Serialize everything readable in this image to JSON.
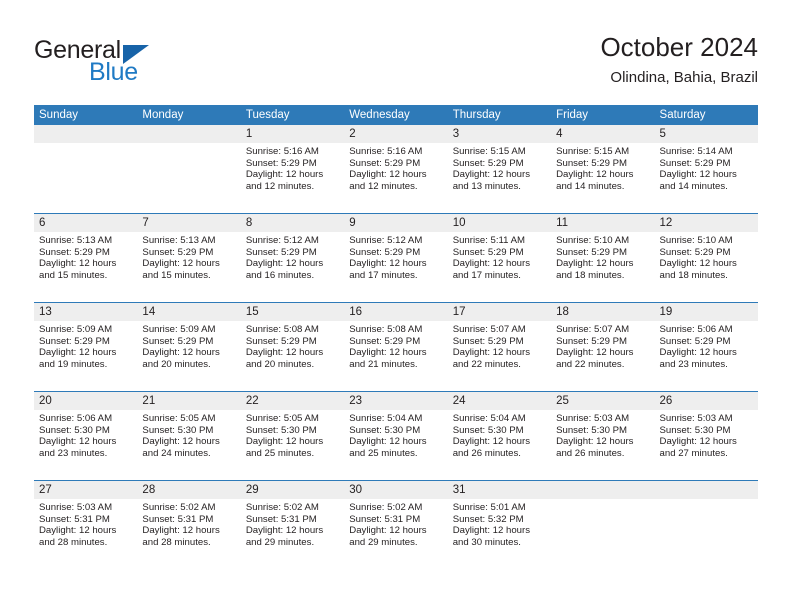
{
  "brand": {
    "word1": "General",
    "word2": "Blue",
    "triangle_color": "#1763a8",
    "blue_text_color": "#1f7ac4"
  },
  "header": {
    "title": "October 2024",
    "subtitle": "Olindina, Bahia, Brazil"
  },
  "theme": {
    "header_blue": "#2e7ab8",
    "number_band_gray": "#eeeeee",
    "text_color": "#231f20"
  },
  "weekday_headers": [
    "Sunday",
    "Monday",
    "Tuesday",
    "Wednesday",
    "Thursday",
    "Friday",
    "Saturday"
  ],
  "labels": {
    "sunrise_prefix": "Sunrise:",
    "sunset_prefix": "Sunset:",
    "daylight_prefix": "Daylight:"
  },
  "weeks": [
    [
      {
        "day": "",
        "line1": "",
        "line2": "",
        "line3": "",
        "line4": ""
      },
      {
        "day": "",
        "line1": "",
        "line2": "",
        "line3": "",
        "line4": ""
      },
      {
        "day": "1",
        "line1": "Sunrise: 5:16 AM",
        "line2": "Sunset: 5:29 PM",
        "line3": "Daylight: 12 hours",
        "line4": "and 12 minutes."
      },
      {
        "day": "2",
        "line1": "Sunrise: 5:16 AM",
        "line2": "Sunset: 5:29 PM",
        "line3": "Daylight: 12 hours",
        "line4": "and 12 minutes."
      },
      {
        "day": "3",
        "line1": "Sunrise: 5:15 AM",
        "line2": "Sunset: 5:29 PM",
        "line3": "Daylight: 12 hours",
        "line4": "and 13 minutes."
      },
      {
        "day": "4",
        "line1": "Sunrise: 5:15 AM",
        "line2": "Sunset: 5:29 PM",
        "line3": "Daylight: 12 hours",
        "line4": "and 14 minutes."
      },
      {
        "day": "5",
        "line1": "Sunrise: 5:14 AM",
        "line2": "Sunset: 5:29 PM",
        "line3": "Daylight: 12 hours",
        "line4": "and 14 minutes."
      }
    ],
    [
      {
        "day": "6",
        "line1": "Sunrise: 5:13 AM",
        "line2": "Sunset: 5:29 PM",
        "line3": "Daylight: 12 hours",
        "line4": "and 15 minutes."
      },
      {
        "day": "7",
        "line1": "Sunrise: 5:13 AM",
        "line2": "Sunset: 5:29 PM",
        "line3": "Daylight: 12 hours",
        "line4": "and 15 minutes."
      },
      {
        "day": "8",
        "line1": "Sunrise: 5:12 AM",
        "line2": "Sunset: 5:29 PM",
        "line3": "Daylight: 12 hours",
        "line4": "and 16 minutes."
      },
      {
        "day": "9",
        "line1": "Sunrise: 5:12 AM",
        "line2": "Sunset: 5:29 PM",
        "line3": "Daylight: 12 hours",
        "line4": "and 17 minutes."
      },
      {
        "day": "10",
        "line1": "Sunrise: 5:11 AM",
        "line2": "Sunset: 5:29 PM",
        "line3": "Daylight: 12 hours",
        "line4": "and 17 minutes."
      },
      {
        "day": "11",
        "line1": "Sunrise: 5:10 AM",
        "line2": "Sunset: 5:29 PM",
        "line3": "Daylight: 12 hours",
        "line4": "and 18 minutes."
      },
      {
        "day": "12",
        "line1": "Sunrise: 5:10 AM",
        "line2": "Sunset: 5:29 PM",
        "line3": "Daylight: 12 hours",
        "line4": "and 18 minutes."
      }
    ],
    [
      {
        "day": "13",
        "line1": "Sunrise: 5:09 AM",
        "line2": "Sunset: 5:29 PM",
        "line3": "Daylight: 12 hours",
        "line4": "and 19 minutes."
      },
      {
        "day": "14",
        "line1": "Sunrise: 5:09 AM",
        "line2": "Sunset: 5:29 PM",
        "line3": "Daylight: 12 hours",
        "line4": "and 20 minutes."
      },
      {
        "day": "15",
        "line1": "Sunrise: 5:08 AM",
        "line2": "Sunset: 5:29 PM",
        "line3": "Daylight: 12 hours",
        "line4": "and 20 minutes."
      },
      {
        "day": "16",
        "line1": "Sunrise: 5:08 AM",
        "line2": "Sunset: 5:29 PM",
        "line3": "Daylight: 12 hours",
        "line4": "and 21 minutes."
      },
      {
        "day": "17",
        "line1": "Sunrise: 5:07 AM",
        "line2": "Sunset: 5:29 PM",
        "line3": "Daylight: 12 hours",
        "line4": "and 22 minutes."
      },
      {
        "day": "18",
        "line1": "Sunrise: 5:07 AM",
        "line2": "Sunset: 5:29 PM",
        "line3": "Daylight: 12 hours",
        "line4": "and 22 minutes."
      },
      {
        "day": "19",
        "line1": "Sunrise: 5:06 AM",
        "line2": "Sunset: 5:29 PM",
        "line3": "Daylight: 12 hours",
        "line4": "and 23 minutes."
      }
    ],
    [
      {
        "day": "20",
        "line1": "Sunrise: 5:06 AM",
        "line2": "Sunset: 5:30 PM",
        "line3": "Daylight: 12 hours",
        "line4": "and 23 minutes."
      },
      {
        "day": "21",
        "line1": "Sunrise: 5:05 AM",
        "line2": "Sunset: 5:30 PM",
        "line3": "Daylight: 12 hours",
        "line4": "and 24 minutes."
      },
      {
        "day": "22",
        "line1": "Sunrise: 5:05 AM",
        "line2": "Sunset: 5:30 PM",
        "line3": "Daylight: 12 hours",
        "line4": "and 25 minutes."
      },
      {
        "day": "23",
        "line1": "Sunrise: 5:04 AM",
        "line2": "Sunset: 5:30 PM",
        "line3": "Daylight: 12 hours",
        "line4": "and 25 minutes."
      },
      {
        "day": "24",
        "line1": "Sunrise: 5:04 AM",
        "line2": "Sunset: 5:30 PM",
        "line3": "Daylight: 12 hours",
        "line4": "and 26 minutes."
      },
      {
        "day": "25",
        "line1": "Sunrise: 5:03 AM",
        "line2": "Sunset: 5:30 PM",
        "line3": "Daylight: 12 hours",
        "line4": "and 26 minutes."
      },
      {
        "day": "26",
        "line1": "Sunrise: 5:03 AM",
        "line2": "Sunset: 5:30 PM",
        "line3": "Daylight: 12 hours",
        "line4": "and 27 minutes."
      }
    ],
    [
      {
        "day": "27",
        "line1": "Sunrise: 5:03 AM",
        "line2": "Sunset: 5:31 PM",
        "line3": "Daylight: 12 hours",
        "line4": "and 28 minutes."
      },
      {
        "day": "28",
        "line1": "Sunrise: 5:02 AM",
        "line2": "Sunset: 5:31 PM",
        "line3": "Daylight: 12 hours",
        "line4": "and 28 minutes."
      },
      {
        "day": "29",
        "line1": "Sunrise: 5:02 AM",
        "line2": "Sunset: 5:31 PM",
        "line3": "Daylight: 12 hours",
        "line4": "and 29 minutes."
      },
      {
        "day": "30",
        "line1": "Sunrise: 5:02 AM",
        "line2": "Sunset: 5:31 PM",
        "line3": "Daylight: 12 hours",
        "line4": "and 29 minutes."
      },
      {
        "day": "31",
        "line1": "Sunrise: 5:01 AM",
        "line2": "Sunset: 5:32 PM",
        "line3": "Daylight: 12 hours",
        "line4": "and 30 minutes."
      },
      {
        "day": "",
        "line1": "",
        "line2": "",
        "line3": "",
        "line4": ""
      },
      {
        "day": "",
        "line1": "",
        "line2": "",
        "line3": "",
        "line4": ""
      }
    ]
  ]
}
